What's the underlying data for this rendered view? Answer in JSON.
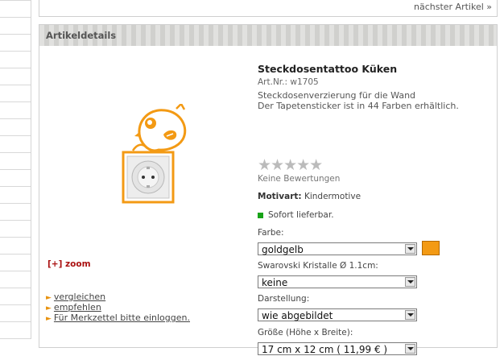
{
  "nav": {
    "next_article": "nächster Artikel »"
  },
  "section": {
    "title": "Artikeldetails"
  },
  "gallery": {
    "zoom_label": "[+] zoom",
    "links": [
      "vergleichen",
      "empfehlen",
      "Für Merkzettel bitte einloggen."
    ]
  },
  "product": {
    "name": "Steckdosentattoo Küken",
    "art_nr": "Art.Nr.: w1705",
    "description_line1": "Steckdosenverzierung für die Wand",
    "description_line2": "Der Tapetensticker ist in 44 Farben erhältlich.",
    "rating_stars": "★★★★★",
    "rating_value": 0,
    "rating_text": "Keine Bewertungen",
    "motiv_label": "Motivart:",
    "motiv_value": "Kindermotive",
    "stock_text": "Sofort lieferbar.",
    "stock_color": "#18a318"
  },
  "options": {
    "color_label": "Farbe:",
    "color_value": "goldgelb",
    "color_swatch": "#f39a14",
    "crystals_label": "Swarovski Kristalle Ø 1.1cm:",
    "crystals_value": "keine",
    "display_label": "Darstellung:",
    "display_value": "wie abgebildet",
    "size_label": "Größe (Höhe x Breite):",
    "size_value": "17 cm x 12 cm ( 11,99 € )"
  }
}
